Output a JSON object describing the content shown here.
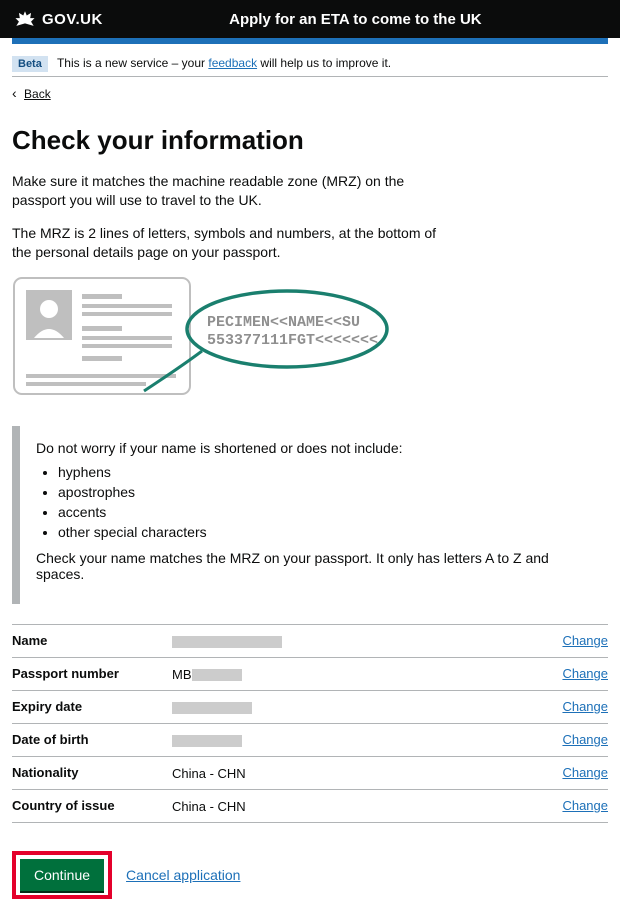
{
  "header": {
    "logo": "GOV.UK",
    "title": "Apply for an ETA to come to the UK"
  },
  "beta": {
    "tag": "Beta",
    "prefix": "This is a new service – your ",
    "link": "feedback",
    "suffix": " will help us to improve it."
  },
  "back": "Back",
  "h1": "Check your information",
  "p1": "Make sure it matches the machine readable zone (MRZ) on the passport you will use to travel to the UK.",
  "p2": "The MRZ is 2 lines of letters, symbols and numbers, at the bottom of the personal details page on your passport.",
  "mrz_line1": "PECIMEN<<NAME<<SU",
  "mrz_line2": "553377111FGT<<<<<<<",
  "inset": {
    "lead": "Do not worry if your name is shortened or does not include:",
    "items": [
      "hyphens",
      "apostrophes",
      "accents",
      "other special characters"
    ],
    "tail": "Check your name matches the MRZ on your passport. It only has letters A to Z and spaces."
  },
  "rows": [
    {
      "key": "Name",
      "val_prefix": "",
      "redact_w": 110,
      "change": "Change"
    },
    {
      "key": "Passport number",
      "val_prefix": "MB",
      "redact_w": 50,
      "change": "Change"
    },
    {
      "key": "Expiry date",
      "val_prefix": "",
      "redact_w": 80,
      "change": "Change"
    },
    {
      "key": "Date of birth",
      "val_prefix": "",
      "redact_w": 70,
      "change": "Change"
    },
    {
      "key": "Nationality",
      "val_prefix": "China - CHN",
      "redact_w": 0,
      "change": "Change"
    },
    {
      "key": "Country of issue",
      "val_prefix": "China - CHN",
      "redact_w": 0,
      "change": "Change"
    }
  ],
  "continue": "Continue",
  "cancel": "Cancel application"
}
